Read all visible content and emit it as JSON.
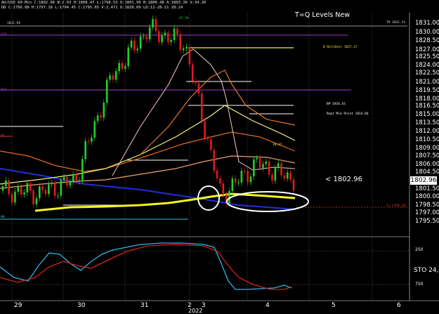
{
  "header": {
    "line1": "AU/USD 60-Min  C:1802.96  N:2.03  H:1808.47  L:1798.53  O:1801.90  B:1800.48  A:1803.36  V:34.2K",
    "line2": "DD  C:1796.88  H:1797.18  L:1794.45  C:1795.65  V:2,471  O:1828.00  LD:12-28-21  28:24"
  },
  "title": "T=Q Levels New",
  "current_price_label": "< 1802.96",
  "current_price_box": "1802.96",
  "indicator_label": "STO  24,",
  "level_labels": {
    "top_left": "1831.94",
    "top_right": "TK 1831.53",
    "peak": "47.28",
    "rollover": "D Roll0ver 1827.17",
    "bp": "BP 1816.61",
    "mid_point": "Rept Mid Point 1814.86",
    "small": "10.27",
    "tl": "TL 1798.20",
    "left_1": "816",
    "left_2": "872",
    "left_3": "86",
    "left_4": "00"
  },
  "price_ticks": [
    "1831.00",
    "1830.00",
    "1828.50",
    "1827.00",
    "1825.50",
    "1824.00",
    "1822.50",
    "1821.00",
    "1819.50",
    "1818.00",
    "1816.50",
    "1815.00",
    "1813.50",
    "1812.00",
    "1810.50",
    "1809.00",
    "1807.50",
    "1806.00",
    "1804.50",
    "1801.50",
    "1800.00",
    "1798.50",
    "1797.00",
    "1795.50"
  ],
  "sto_ticks": [
    "250",
    "750"
  ],
  "time_ticks": [
    "29",
    "30",
    "31",
    "2",
    "3",
    "4",
    "5",
    "6"
  ],
  "year": "2022",
  "colors": {
    "yellow_ma": "#f5f522",
    "blue_ma": "#2230d8",
    "orange_ma": "#e06b1c",
    "level_magenta": "#b23bd6",
    "level_white": "#ffffff",
    "stoch_fast": "#29b6e6",
    "stoch_slow": "#d61f1f",
    "up_candle": "#23d12c",
    "down_candle": "#e01b1b"
  },
  "chart_data": {
    "type": "line",
    "symbol": "AU/USD",
    "timeframe": "60-Min",
    "ylim": [
      1795,
      1832
    ],
    "x": [
      "29",
      "30",
      "31",
      "2",
      "3",
      "4",
      "5",
      "6"
    ],
    "series": [
      {
        "values": [
          1801,
          1800.5,
          1803,
          1822,
          1830.5,
          1828,
          1800,
          1806,
          1802.96
        ]
      }
    ],
    "levels": [
      1831.53,
      1827.17,
      1816.61,
      1814.86,
      1798.2
    ]
  }
}
